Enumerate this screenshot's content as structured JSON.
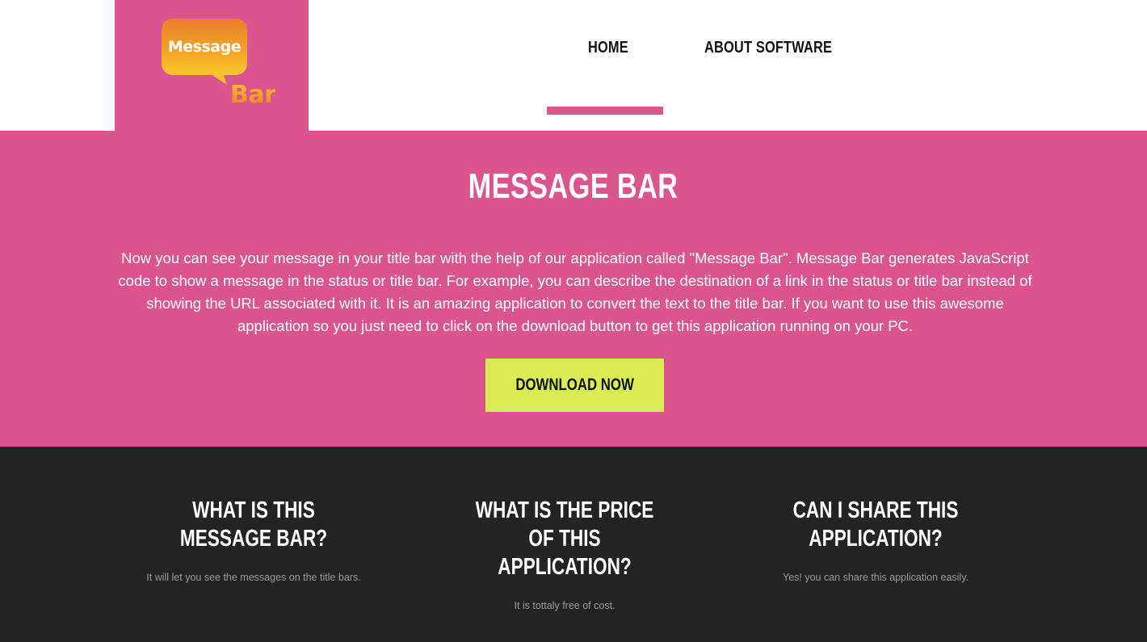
{
  "logo": {
    "line1": "Message",
    "line2": "Bar"
  },
  "nav": {
    "items": [
      {
        "label": "HOME"
      },
      {
        "label": "ABOUT SOFTWARE"
      }
    ]
  },
  "hero": {
    "title": "MESSAGE BAR",
    "description": "Now you can see your message in your title bar with the help of our application called \"Message Bar\". Message Bar generates JavaScript code to show a message in the status or title bar. For example, you can describe the destination of a link in the status or title bar instead of showing the URL associated with it. It is an amazing application to convert the text to the title bar. If you want to use this awesome application so you just need to click on the download button to get this application running on your PC.",
    "download_label": "DOWNLOAD NOW"
  },
  "faq": [
    {
      "question": "WHAT IS THIS MESSAGE BAR?",
      "answer": "It will let you see the messages on the title bars."
    },
    {
      "question": "WHAT IS THE PRICE OF THIS APPLICATION?",
      "answer": "It is tottaly free of cost."
    },
    {
      "question": "CAN I SHARE THIS APPLICATION?",
      "answer": "Yes! you can share this application easily."
    }
  ],
  "colors": {
    "accent_pink": "#dc548e",
    "button_yellow": "#dbec52",
    "footer_dark": "#232323"
  }
}
